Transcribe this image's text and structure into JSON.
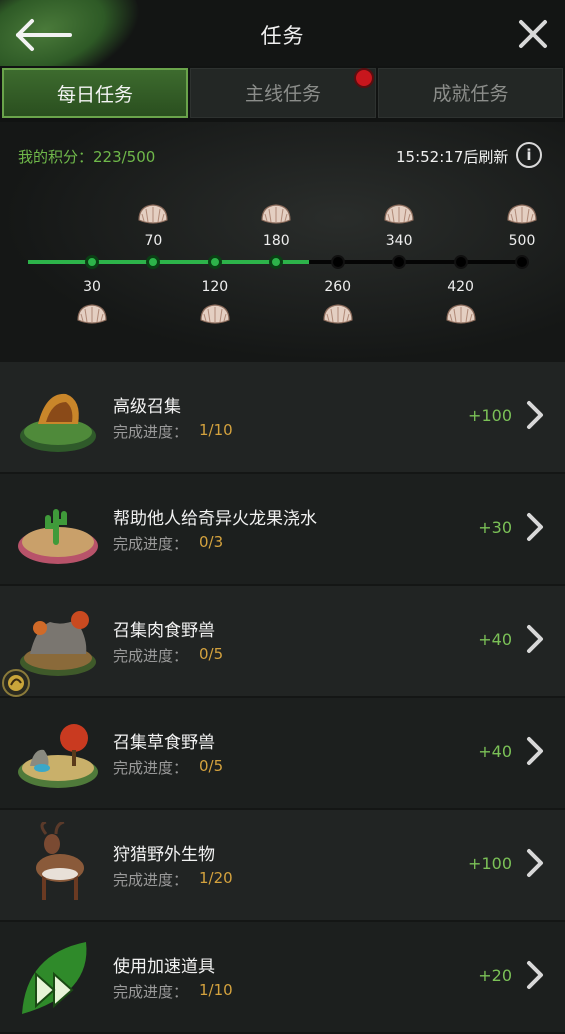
{
  "header": {
    "title": "任务",
    "back_icon": "arrow-left-icon",
    "close_icon": "close-icon"
  },
  "tabs": [
    {
      "label": "每日任务",
      "active": true
    },
    {
      "label": "主线任务",
      "active": false,
      "has_notification": true
    },
    {
      "label": "成就任务",
      "active": false
    }
  ],
  "daily": {
    "score_label": "我的积分：223/500",
    "score": 223,
    "score_max": 500,
    "refresh_text": "15:52:17后刷新",
    "info_glyph": "i",
    "milestones": [
      {
        "value": "30",
        "reached": true
      },
      {
        "value": "70",
        "reached": true
      },
      {
        "value": "120",
        "reached": true
      },
      {
        "value": "180",
        "reached": true
      },
      {
        "value": "260",
        "reached": false
      },
      {
        "value": "340",
        "reached": false
      },
      {
        "value": "420",
        "reached": false
      },
      {
        "value": "500",
        "reached": false
      }
    ],
    "reward_icon": "shell-icon"
  },
  "tasks": [
    {
      "name": "高级召集",
      "progress_label": "完成进度：",
      "progress": "1/10",
      "points": "+100",
      "icon": "volcano-island-icon"
    },
    {
      "name": "帮助他人给奇异火龙果浇水",
      "progress_label": "完成进度：",
      "progress": "0/3",
      "points": "+30",
      "icon": "cactus-island-icon"
    },
    {
      "name": "召集肉食野兽",
      "progress_label": "完成进度：",
      "progress": "0/5",
      "points": "+40",
      "icon": "carnivore-island-icon"
    },
    {
      "name": "召集草食野兽",
      "progress_label": "完成进度：",
      "progress": "0/5",
      "points": "+40",
      "icon": "herbivore-island-icon"
    },
    {
      "name": "狩猎野外生物",
      "progress_label": "完成进度：",
      "progress": "1/20",
      "points": "+100",
      "icon": "antelope-icon"
    },
    {
      "name": "使用加速道具",
      "progress_label": "完成进度：",
      "progress": "1/10",
      "points": "+20",
      "icon": "speedup-leaf-icon"
    }
  ],
  "colors": {
    "accent_green": "#6fb84a",
    "progress_orange": "#d4a23e",
    "notification_red": "#c8161d"
  }
}
